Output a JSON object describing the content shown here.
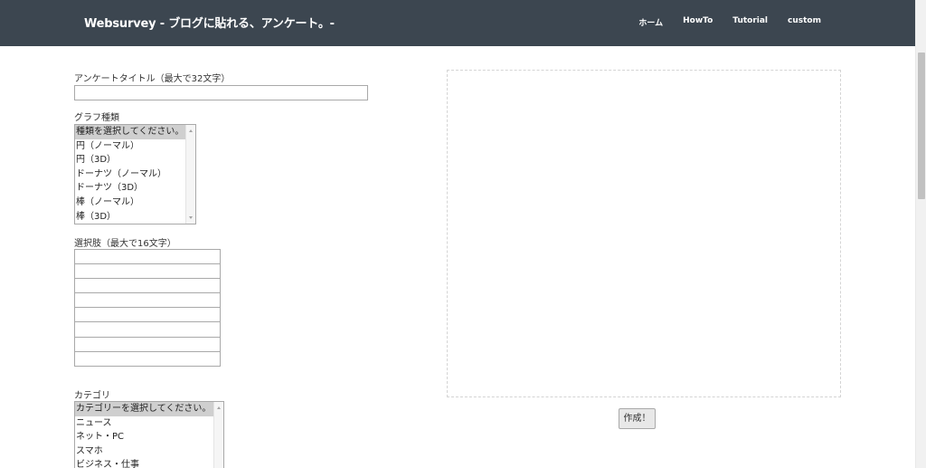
{
  "header": {
    "brand": "Websurvey - ブログに貼れる、アンケート。-",
    "nav": [
      "ホーム",
      "HowTo",
      "Tutorial",
      "custom"
    ]
  },
  "form": {
    "title_label": "アンケートタイトル（最大で32文字）",
    "title_value": "",
    "graph_label": "グラフ種類",
    "graph_options": [
      "種類を選択してください。",
      "円（ノーマル）",
      "円（3D）",
      "ドーナツ（ノーマル）",
      "ドーナツ（3D）",
      "棒（ノーマル）",
      "棒（3D）"
    ],
    "graph_selected": "種類を選択してください。",
    "choices_label": "選択肢（最大で16文字）",
    "choices_values": [
      "",
      "",
      "",
      "",
      "",
      "",
      "",
      ""
    ],
    "category_label": "カテゴリ",
    "category_options": [
      "カテゴリーを選択してください。",
      "ニュース",
      "ネット・PC",
      "スマホ",
      "ビジネス・仕事"
    ],
    "category_selected": "カテゴリーを選択してください。"
  },
  "preview": {
    "create_button": "作成！"
  },
  "colors": {
    "header_bg": "#3c4650",
    "selected_option_bg": "#cfcfcf"
  }
}
